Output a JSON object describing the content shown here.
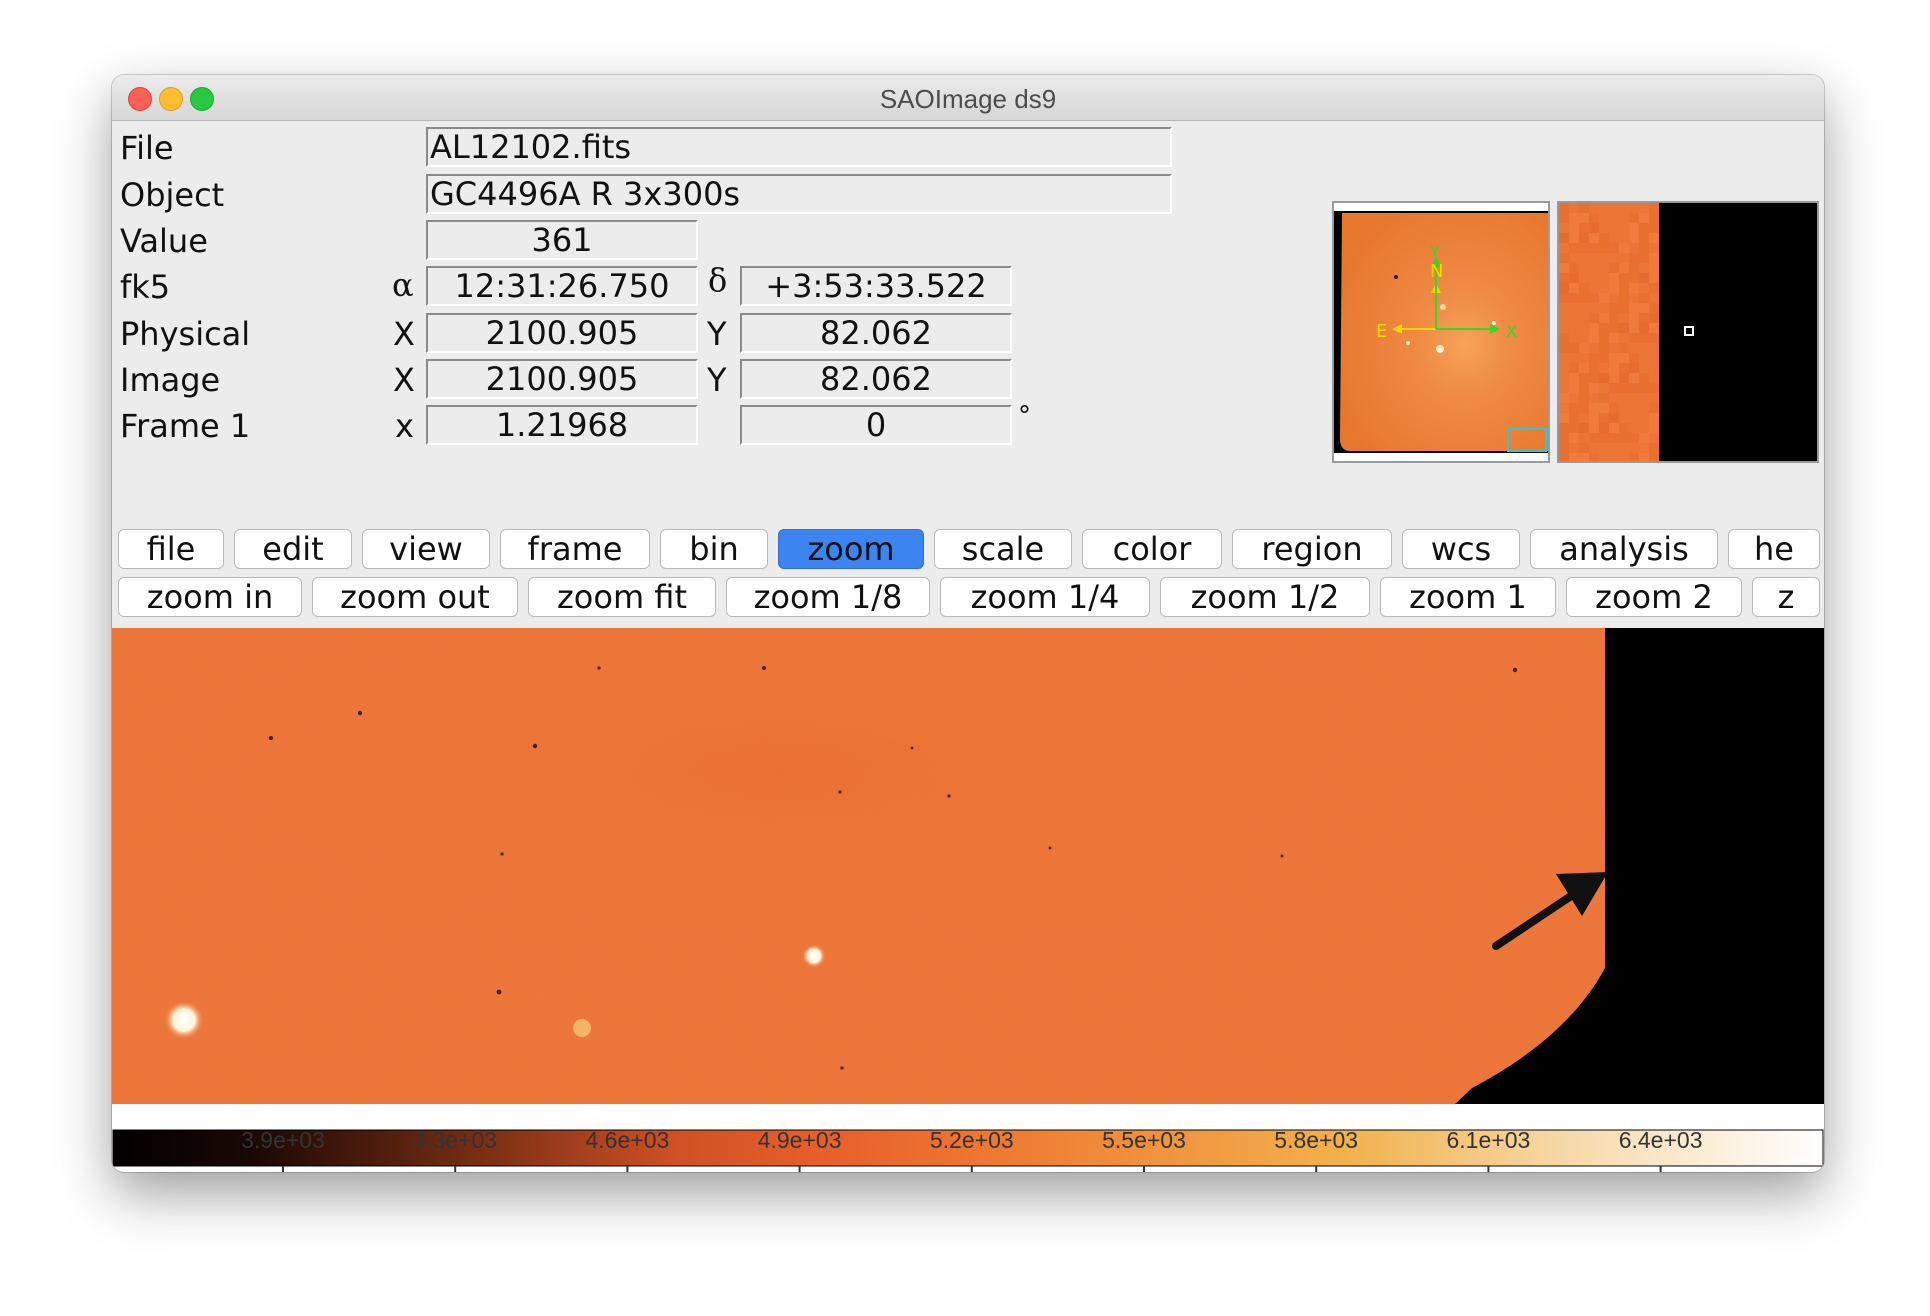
{
  "window": {
    "title": "SAOImage ds9"
  },
  "info": {
    "file": {
      "label": "File",
      "value": "AL12102.fits"
    },
    "object": {
      "label": "Object",
      "value": "GC4496A R 3x300s"
    },
    "value": {
      "label": "Value",
      "value": "361"
    },
    "fk5": {
      "label": "fk5",
      "alpha_symbol": "α",
      "alpha": "12:31:26.750",
      "delta_symbol": "δ",
      "delta": "+3:53:33.522"
    },
    "physical": {
      "label": "Physical",
      "x_symbol": "X",
      "x": "2100.905",
      "y_symbol": "Y",
      "y": "82.062"
    },
    "image": {
      "label": "Image",
      "x_symbol": "X",
      "x": "2100.905",
      "y_symbol": "Y",
      "y": "82.062"
    },
    "frame": {
      "label": "Frame 1",
      "zoom_symbol": "x",
      "zoom": "1.21968",
      "angle": "0",
      "degree_symbol": "°"
    }
  },
  "panner": {
    "north_label": "N",
    "east_label": "E",
    "x_axis_label": "X",
    "y_axis_label": "Y"
  },
  "menu": {
    "buttons": [
      {
        "label": "file",
        "active": false
      },
      {
        "label": "edit",
        "active": false
      },
      {
        "label": "view",
        "active": false
      },
      {
        "label": "frame",
        "active": false
      },
      {
        "label": "bin",
        "active": false
      },
      {
        "label": "zoom",
        "active": true
      },
      {
        "label": "scale",
        "active": false
      },
      {
        "label": "color",
        "active": false
      },
      {
        "label": "region",
        "active": false
      },
      {
        "label": "wcs",
        "active": false
      },
      {
        "label": "analysis",
        "active": false
      },
      {
        "label": "he",
        "active": false
      }
    ]
  },
  "zoom_bar": {
    "buttons": [
      {
        "label": "zoom in"
      },
      {
        "label": "zoom out"
      },
      {
        "label": "zoom fit"
      },
      {
        "label": "zoom 1/8"
      },
      {
        "label": "zoom 1/4"
      },
      {
        "label": "zoom 1/2"
      },
      {
        "label": "zoom 1"
      },
      {
        "label": "zoom 2"
      },
      {
        "label": "z"
      }
    ]
  },
  "colorbar": {
    "ticks": [
      "3.9e+03",
      "4.3e+03",
      "4.6e+03",
      "4.9e+03",
      "5.2e+03",
      "5.5e+03",
      "5.8e+03",
      "6.1e+03",
      "6.4e+03"
    ]
  },
  "colors": {
    "image_orange": "#ec7336",
    "active_button": "#3c84f0",
    "compass_yellow": "#f5d800",
    "compass_green": "#35d62d",
    "panner_box": "#2ec7d6"
  }
}
